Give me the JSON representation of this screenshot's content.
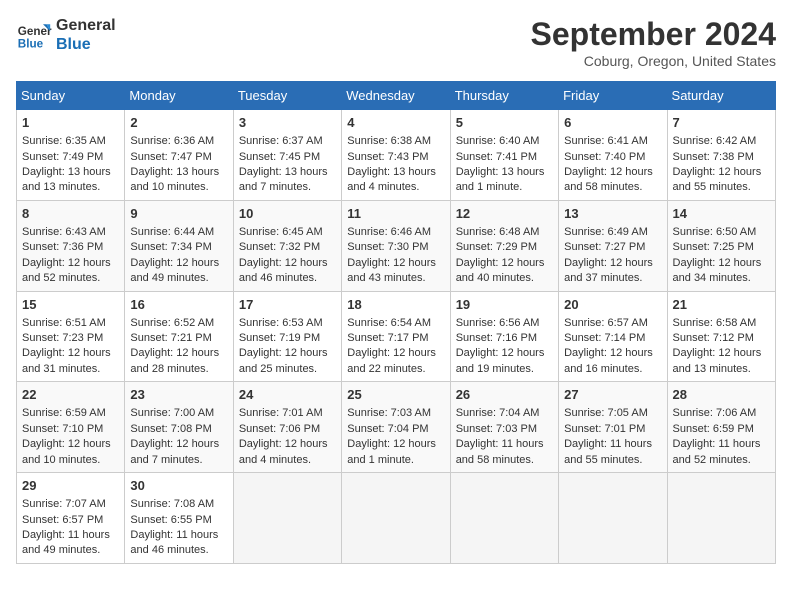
{
  "header": {
    "logo_line1": "General",
    "logo_line2": "Blue",
    "title": "September 2024",
    "subtitle": "Coburg, Oregon, United States"
  },
  "days_of_week": [
    "Sunday",
    "Monday",
    "Tuesday",
    "Wednesday",
    "Thursday",
    "Friday",
    "Saturday"
  ],
  "weeks": [
    [
      {
        "day": "1",
        "info": "Sunrise: 6:35 AM\nSunset: 7:49 PM\nDaylight: 13 hours\nand 13 minutes."
      },
      {
        "day": "2",
        "info": "Sunrise: 6:36 AM\nSunset: 7:47 PM\nDaylight: 13 hours\nand 10 minutes."
      },
      {
        "day": "3",
        "info": "Sunrise: 6:37 AM\nSunset: 7:45 PM\nDaylight: 13 hours\nand 7 minutes."
      },
      {
        "day": "4",
        "info": "Sunrise: 6:38 AM\nSunset: 7:43 PM\nDaylight: 13 hours\nand 4 minutes."
      },
      {
        "day": "5",
        "info": "Sunrise: 6:40 AM\nSunset: 7:41 PM\nDaylight: 13 hours\nand 1 minute."
      },
      {
        "day": "6",
        "info": "Sunrise: 6:41 AM\nSunset: 7:40 PM\nDaylight: 12 hours\nand 58 minutes."
      },
      {
        "day": "7",
        "info": "Sunrise: 6:42 AM\nSunset: 7:38 PM\nDaylight: 12 hours\nand 55 minutes."
      }
    ],
    [
      {
        "day": "8",
        "info": "Sunrise: 6:43 AM\nSunset: 7:36 PM\nDaylight: 12 hours\nand 52 minutes."
      },
      {
        "day": "9",
        "info": "Sunrise: 6:44 AM\nSunset: 7:34 PM\nDaylight: 12 hours\nand 49 minutes."
      },
      {
        "day": "10",
        "info": "Sunrise: 6:45 AM\nSunset: 7:32 PM\nDaylight: 12 hours\nand 46 minutes."
      },
      {
        "day": "11",
        "info": "Sunrise: 6:46 AM\nSunset: 7:30 PM\nDaylight: 12 hours\nand 43 minutes."
      },
      {
        "day": "12",
        "info": "Sunrise: 6:48 AM\nSunset: 7:29 PM\nDaylight: 12 hours\nand 40 minutes."
      },
      {
        "day": "13",
        "info": "Sunrise: 6:49 AM\nSunset: 7:27 PM\nDaylight: 12 hours\nand 37 minutes."
      },
      {
        "day": "14",
        "info": "Sunrise: 6:50 AM\nSunset: 7:25 PM\nDaylight: 12 hours\nand 34 minutes."
      }
    ],
    [
      {
        "day": "15",
        "info": "Sunrise: 6:51 AM\nSunset: 7:23 PM\nDaylight: 12 hours\nand 31 minutes."
      },
      {
        "day": "16",
        "info": "Sunrise: 6:52 AM\nSunset: 7:21 PM\nDaylight: 12 hours\nand 28 minutes."
      },
      {
        "day": "17",
        "info": "Sunrise: 6:53 AM\nSunset: 7:19 PM\nDaylight: 12 hours\nand 25 minutes."
      },
      {
        "day": "18",
        "info": "Sunrise: 6:54 AM\nSunset: 7:17 PM\nDaylight: 12 hours\nand 22 minutes."
      },
      {
        "day": "19",
        "info": "Sunrise: 6:56 AM\nSunset: 7:16 PM\nDaylight: 12 hours\nand 19 minutes."
      },
      {
        "day": "20",
        "info": "Sunrise: 6:57 AM\nSunset: 7:14 PM\nDaylight: 12 hours\nand 16 minutes."
      },
      {
        "day": "21",
        "info": "Sunrise: 6:58 AM\nSunset: 7:12 PM\nDaylight: 12 hours\nand 13 minutes."
      }
    ],
    [
      {
        "day": "22",
        "info": "Sunrise: 6:59 AM\nSunset: 7:10 PM\nDaylight: 12 hours\nand 10 minutes."
      },
      {
        "day": "23",
        "info": "Sunrise: 7:00 AM\nSunset: 7:08 PM\nDaylight: 12 hours\nand 7 minutes."
      },
      {
        "day": "24",
        "info": "Sunrise: 7:01 AM\nSunset: 7:06 PM\nDaylight: 12 hours\nand 4 minutes."
      },
      {
        "day": "25",
        "info": "Sunrise: 7:03 AM\nSunset: 7:04 PM\nDaylight: 12 hours\nand 1 minute."
      },
      {
        "day": "26",
        "info": "Sunrise: 7:04 AM\nSunset: 7:03 PM\nDaylight: 11 hours\nand 58 minutes."
      },
      {
        "day": "27",
        "info": "Sunrise: 7:05 AM\nSunset: 7:01 PM\nDaylight: 11 hours\nand 55 minutes."
      },
      {
        "day": "28",
        "info": "Sunrise: 7:06 AM\nSunset: 6:59 PM\nDaylight: 11 hours\nand 52 minutes."
      }
    ],
    [
      {
        "day": "29",
        "info": "Sunrise: 7:07 AM\nSunset: 6:57 PM\nDaylight: 11 hours\nand 49 minutes."
      },
      {
        "day": "30",
        "info": "Sunrise: 7:08 AM\nSunset: 6:55 PM\nDaylight: 11 hours\nand 46 minutes."
      },
      {
        "day": "",
        "info": "",
        "empty": true
      },
      {
        "day": "",
        "info": "",
        "empty": true
      },
      {
        "day": "",
        "info": "",
        "empty": true
      },
      {
        "day": "",
        "info": "",
        "empty": true
      },
      {
        "day": "",
        "info": "",
        "empty": true
      }
    ]
  ]
}
